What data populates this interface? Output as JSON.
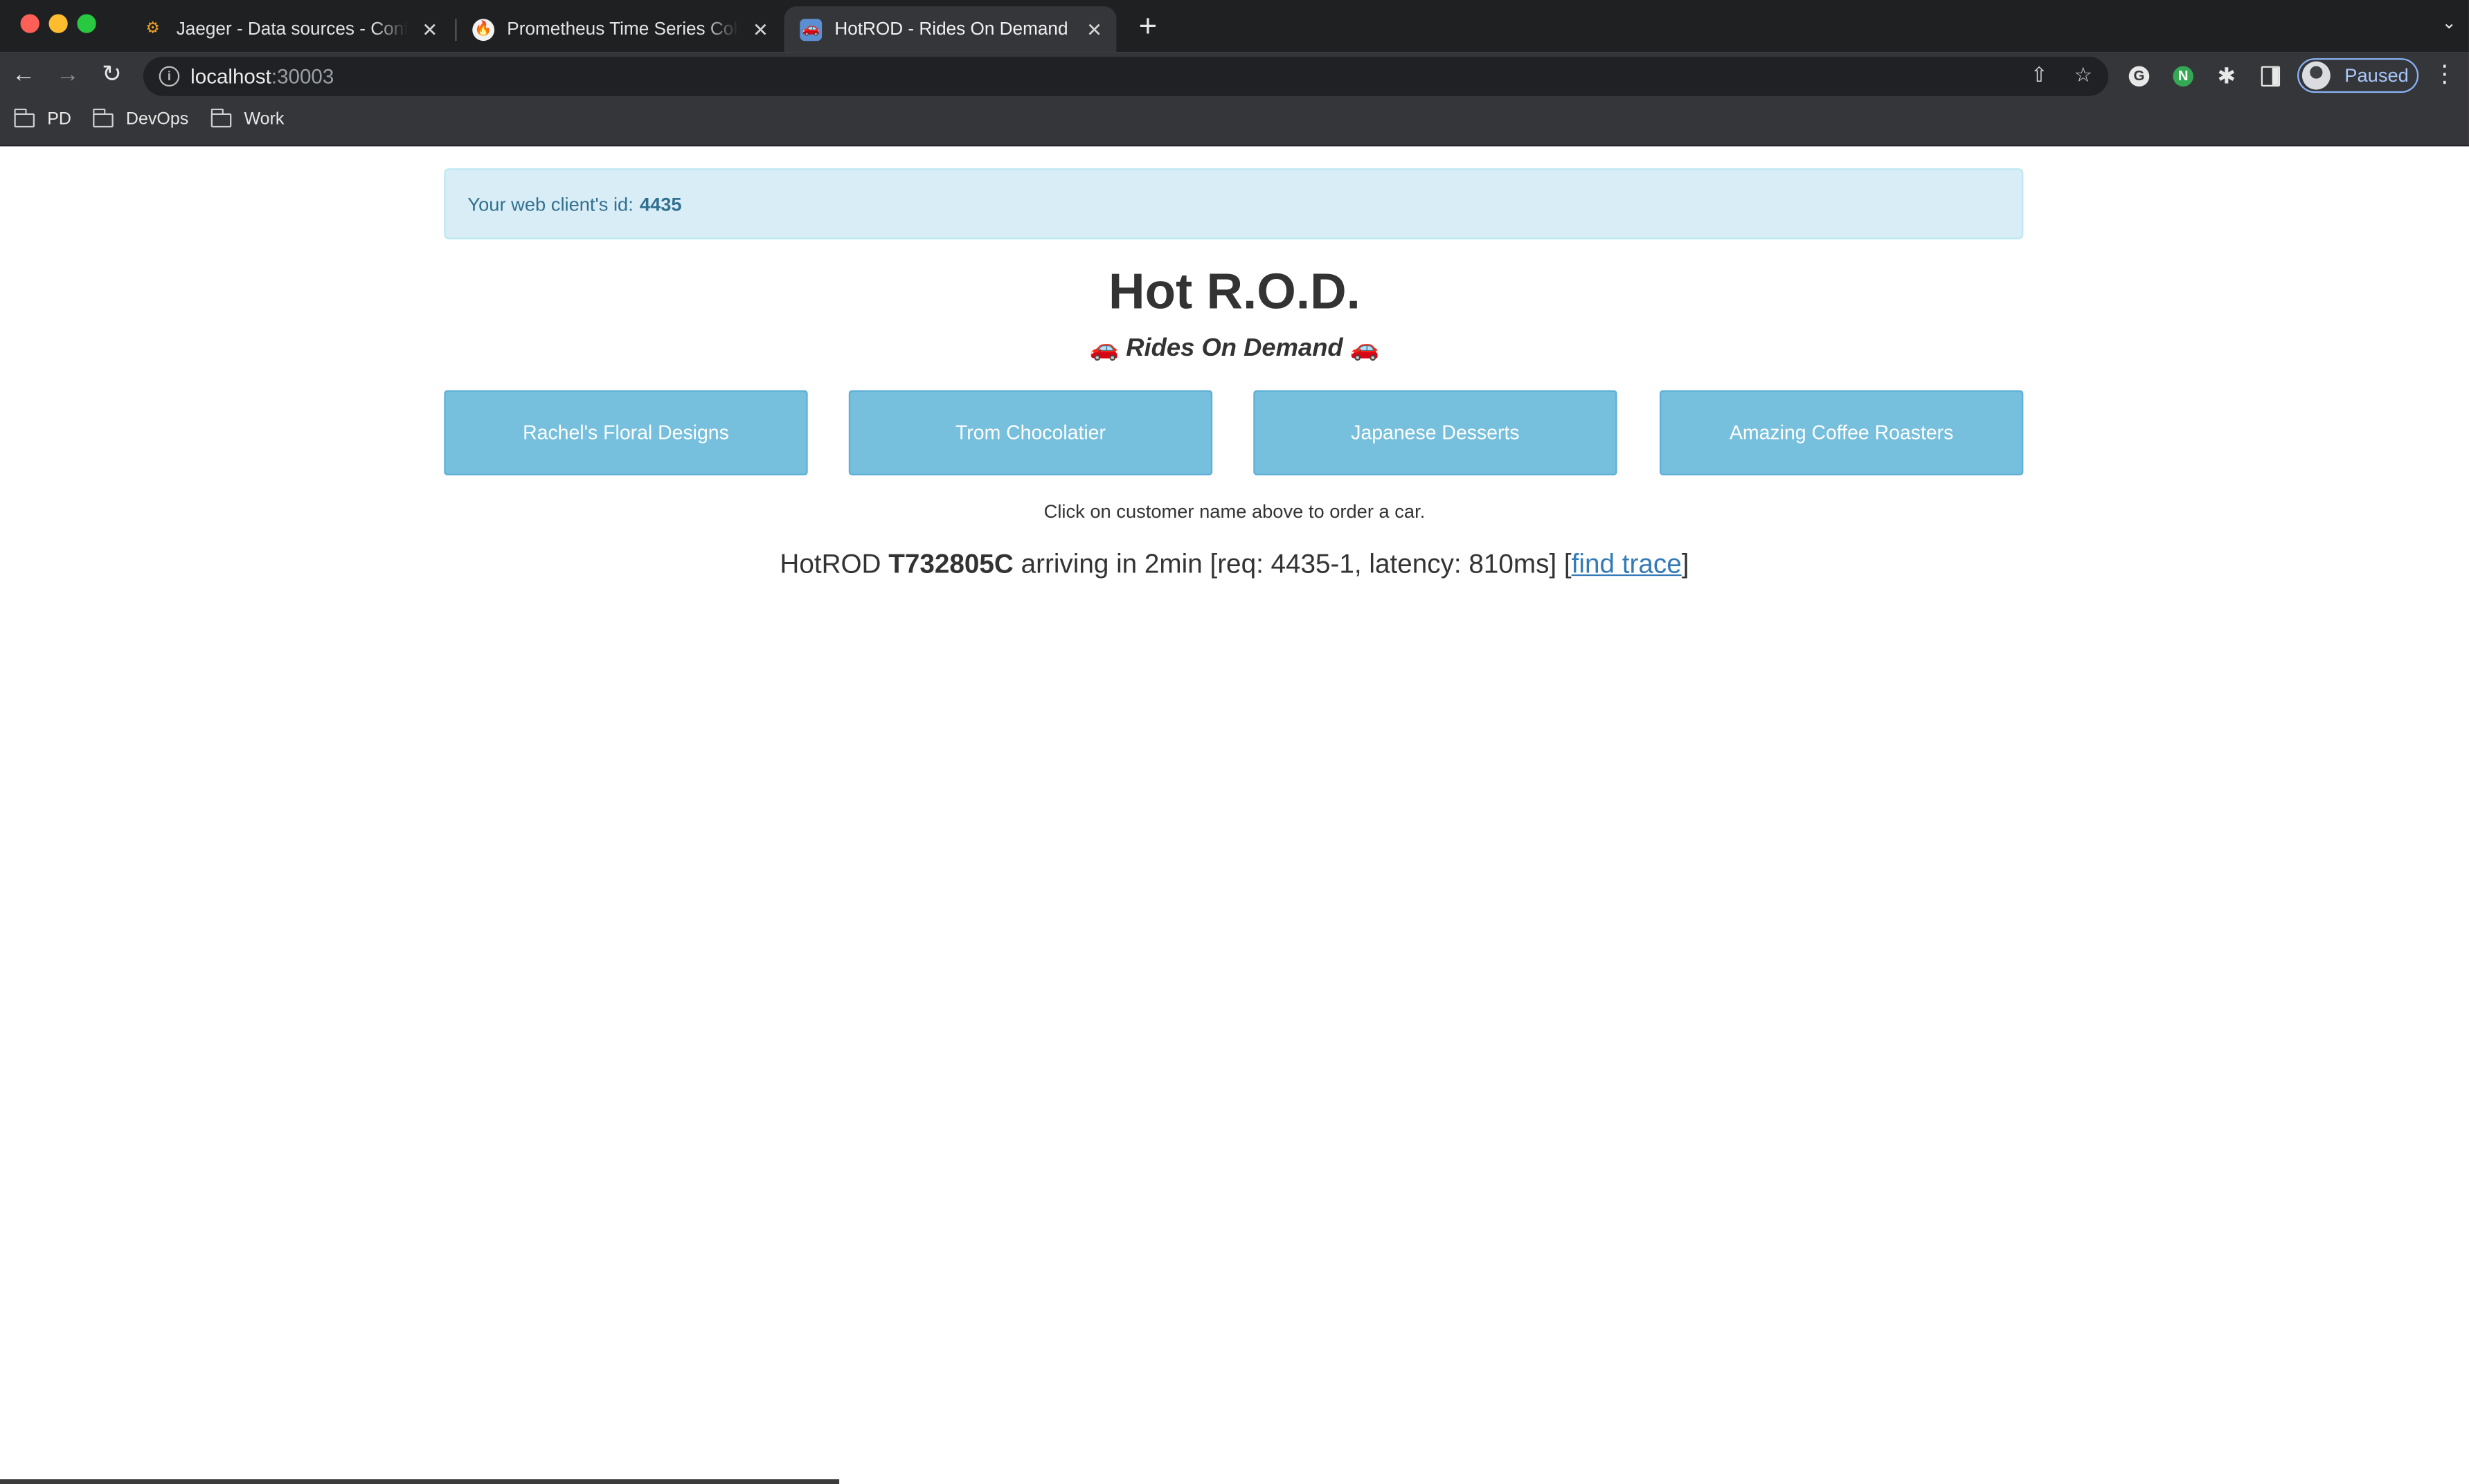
{
  "browser": {
    "tabs": [
      {
        "title": "Jaeger - Data sources - Configuration",
        "favicon": "grafana-icon",
        "active": false
      },
      {
        "title": "Prometheus Time Series Collection",
        "favicon": "prometheus-icon",
        "active": false
      },
      {
        "title": "HotROD - Rides On Demand",
        "favicon": "hotrod-icon",
        "active": true
      }
    ],
    "address": {
      "host": "localhost",
      "port": ":30003"
    },
    "profile_label": "Paused",
    "bookmarks": [
      "PD",
      "DevOps",
      "Work"
    ]
  },
  "page": {
    "client_alert": {
      "text": "Your web client's id:",
      "id": "4435"
    },
    "title": "Hot R.O.D.",
    "subtitle": {
      "text": "Rides On Demand",
      "car_glyph": "🚗"
    },
    "customers": [
      "Rachel's Floral Designs",
      "Trom Chocolatier",
      "Japanese Desserts",
      "Amazing Coffee Roasters"
    ],
    "hint": "Click on customer name above to order a car.",
    "result": {
      "prefix": "HotROD",
      "driver": "T732805C",
      "details": "arriving in 2min [req: 4435-1, latency: 810ms] [",
      "link": "find trace",
      "suffix": "]"
    },
    "load_progress": 0.34
  },
  "colors": {
    "button": "#76bfdd",
    "alert_bg": "#d9edf7",
    "alert_text": "#31708f",
    "link": "#337ab7"
  }
}
